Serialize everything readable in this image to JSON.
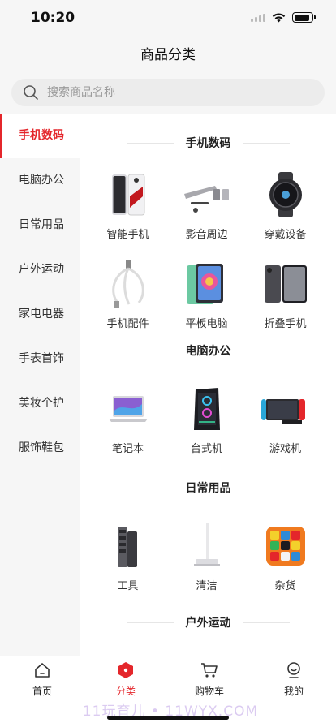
{
  "status": {
    "time": "10:20",
    "battery_level": 0.9
  },
  "nav": {
    "title": "商品分类"
  },
  "search": {
    "placeholder": "搜索商品名称"
  },
  "sidebar": {
    "active_index": 0,
    "items": [
      {
        "label": "手机数码"
      },
      {
        "label": "电脑办公"
      },
      {
        "label": "日常用品"
      },
      {
        "label": "户外运动"
      },
      {
        "label": "家电电器"
      },
      {
        "label": "手表首饰"
      },
      {
        "label": "美妆个护"
      },
      {
        "label": "服饰鞋包"
      }
    ]
  },
  "sections": [
    {
      "title": "手机数码",
      "items": [
        {
          "label": "智能手机",
          "icon": "smartphone-icon"
        },
        {
          "label": "影音周边",
          "icon": "soundbar-icon"
        },
        {
          "label": "穿戴设备",
          "icon": "smartwatch-icon"
        },
        {
          "label": "手机配件",
          "icon": "usb-cable-icon"
        },
        {
          "label": "平板电脑",
          "icon": "tablet-icon"
        },
        {
          "label": "折叠手机",
          "icon": "foldable-phone-icon"
        }
      ]
    },
    {
      "title": "电脑办公",
      "items": [
        {
          "label": "笔记本",
          "icon": "laptop-icon"
        },
        {
          "label": "台式机",
          "icon": "desktop-tower-icon"
        },
        {
          "label": "游戏机",
          "icon": "game-console-icon"
        }
      ]
    },
    {
      "title": "日常用品",
      "items": [
        {
          "label": "工具",
          "icon": "screwdriver-set-icon"
        },
        {
          "label": "清洁",
          "icon": "mop-icon"
        },
        {
          "label": "杂货",
          "icon": "rubiks-cube-icon"
        }
      ]
    },
    {
      "title": "户外运动",
      "items": []
    }
  ],
  "tabbar": {
    "active_index": 1,
    "items": [
      {
        "label": "首页",
        "icon": "home-icon"
      },
      {
        "label": "分类",
        "icon": "category-icon"
      },
      {
        "label": "购物车",
        "icon": "cart-icon"
      },
      {
        "label": "我的",
        "icon": "profile-icon"
      }
    ]
  },
  "watermark": "11玩育儿 • 11WYX.COM",
  "colors": {
    "accent": "#e4262b",
    "background": "#f6f6f6",
    "panel": "#ffffff"
  }
}
